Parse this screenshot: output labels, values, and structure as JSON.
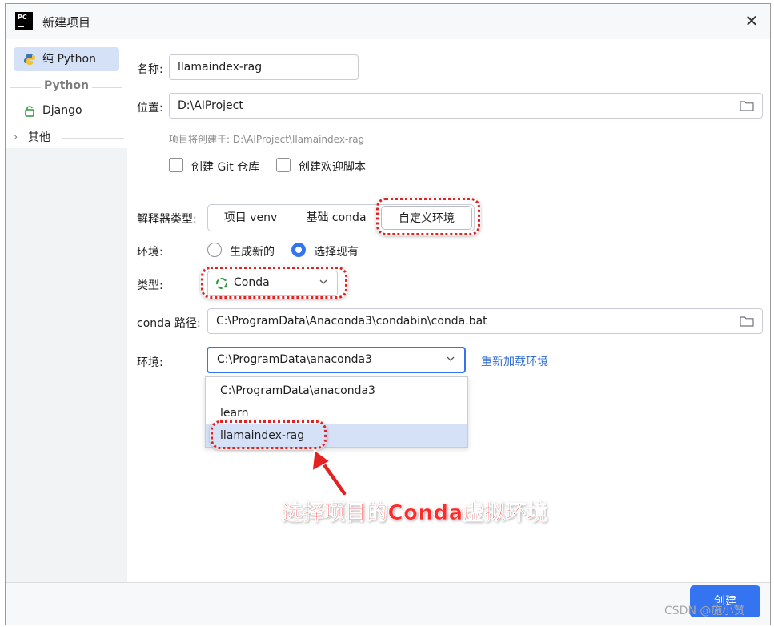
{
  "window": {
    "title": "新建项目",
    "app_icon_text": "PC",
    "close_label": "✕"
  },
  "sidebar": {
    "items": [
      {
        "label": "纯 Python",
        "icon": "python-icon",
        "selected": true
      },
      {
        "label": "Django",
        "icon": "django-icon",
        "selected": false
      }
    ],
    "group_python": "Python",
    "other": "其他"
  },
  "form": {
    "name_label": "名称:",
    "name_value": "llamaindex-rag",
    "location_label": "位置:",
    "location_value": "D:\\AIProject",
    "hint": "项目将创建于: D:\\AIProject\\llamaindex-rag",
    "checkbox_git": "创建 Git 仓库",
    "checkbox_welcome": "创建欢迎脚本",
    "interpreter_label": "解释器类型:",
    "interpreter_options": [
      "项目 venv",
      "基础 conda",
      "自定义环境"
    ],
    "interpreter_selected": "自定义环境",
    "env_mode_label": "环境:",
    "env_mode_new": "生成新的",
    "env_mode_existing": "选择现有",
    "type_label": "类型:",
    "type_value": "Conda",
    "conda_path_label": "conda 路径:",
    "conda_path_value": "C:\\ProgramData\\Anaconda3\\condabin\\conda.bat",
    "env_label": "环境:",
    "env_value": "C:\\ProgramData\\anaconda3",
    "reload_link": "重新加载环境",
    "env_options": [
      "C:\\ProgramData\\anaconda3",
      "learn",
      "llamaindex-rag"
    ],
    "env_highlighted": "llamaindex-rag"
  },
  "annotation": {
    "text": "选择项目的Conda虚拟环境",
    "color": "#ff2b2b"
  },
  "footer": {
    "create_button": "创建",
    "watermark": "CSDN @施小赞"
  },
  "colors": {
    "accent": "#3574f0",
    "selection": "#d5e1f7",
    "link": "#2e6bd1",
    "annotation": "#e22222"
  }
}
